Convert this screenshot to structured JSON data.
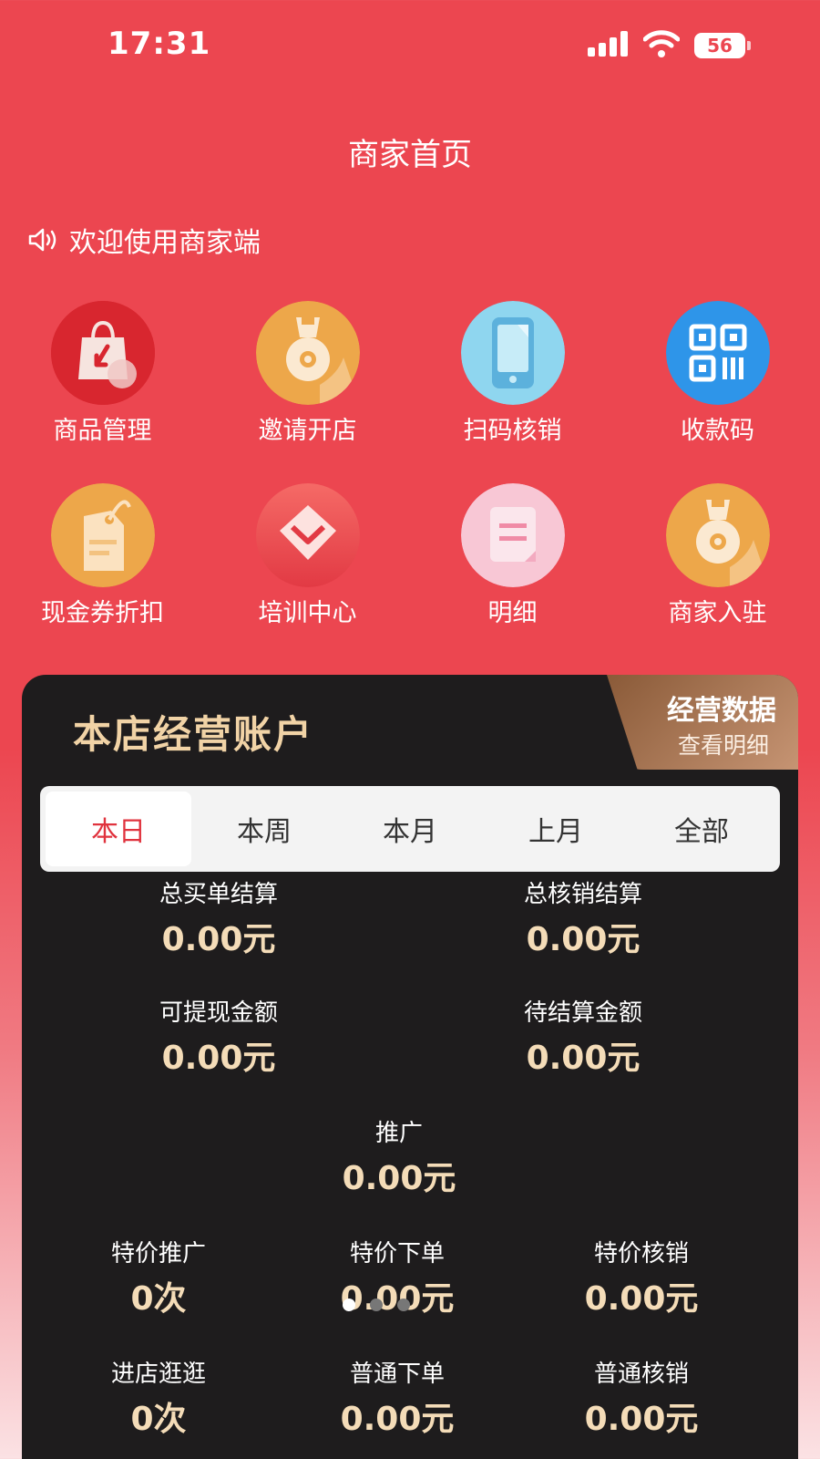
{
  "status": {
    "time": "17:31",
    "battery": "56"
  },
  "header": {
    "title": "商家首页"
  },
  "notice": {
    "text": "欢迎使用商家端"
  },
  "grid": {
    "items": [
      {
        "label": "商品管理",
        "icon": "shopping-bag-icon"
      },
      {
        "label": "邀请开店",
        "icon": "medal-icon"
      },
      {
        "label": "扫码核销",
        "icon": "phone-icon"
      },
      {
        "label": "收款码",
        "icon": "qr-code-icon"
      },
      {
        "label": "现金券折扣",
        "icon": "price-tag-icon"
      },
      {
        "label": "培训中心",
        "icon": "diamond-icon"
      },
      {
        "label": "明细",
        "icon": "document-icon"
      },
      {
        "label": "商家入驻",
        "icon": "medal-icon"
      }
    ]
  },
  "account": {
    "title": "本店经营账户",
    "tag_line1": "经营数据",
    "tag_line2": "查看明细",
    "tabs": [
      "本日",
      "本周",
      "本月",
      "上月",
      "全部"
    ],
    "active_tab": "本日",
    "stats": {
      "total_purchase": {
        "label": "总买单结算",
        "value": "0.00元"
      },
      "total_verify": {
        "label": "总核销结算",
        "value": "0.00元"
      },
      "withdrawable": {
        "label": "可提现金额",
        "value": "0.00元"
      },
      "pending": {
        "label": "待结算金额",
        "value": "0.00元"
      },
      "promotion": {
        "label": "推广",
        "value": "0.00元"
      },
      "special_promo": {
        "label": "特价推广",
        "value": "0次"
      },
      "special_order": {
        "label": "特价下单",
        "value": "0.00元"
      },
      "special_verify": {
        "label": "特价核销",
        "value": "0.00元"
      },
      "visit_store": {
        "label": "进店逛逛",
        "value": "0次"
      },
      "normal_order": {
        "label": "普通下单",
        "value": "0.00元"
      },
      "normal_verify": {
        "label": "普通核销",
        "value": "0.00元"
      }
    }
  },
  "colors": {
    "brand_red": "#ec4650",
    "card_dark": "#1e1c1d",
    "gold_text": "#f4dcb8",
    "active_tab_text": "#e0333e"
  },
  "carousel": {
    "pages": 3,
    "active": 1
  }
}
